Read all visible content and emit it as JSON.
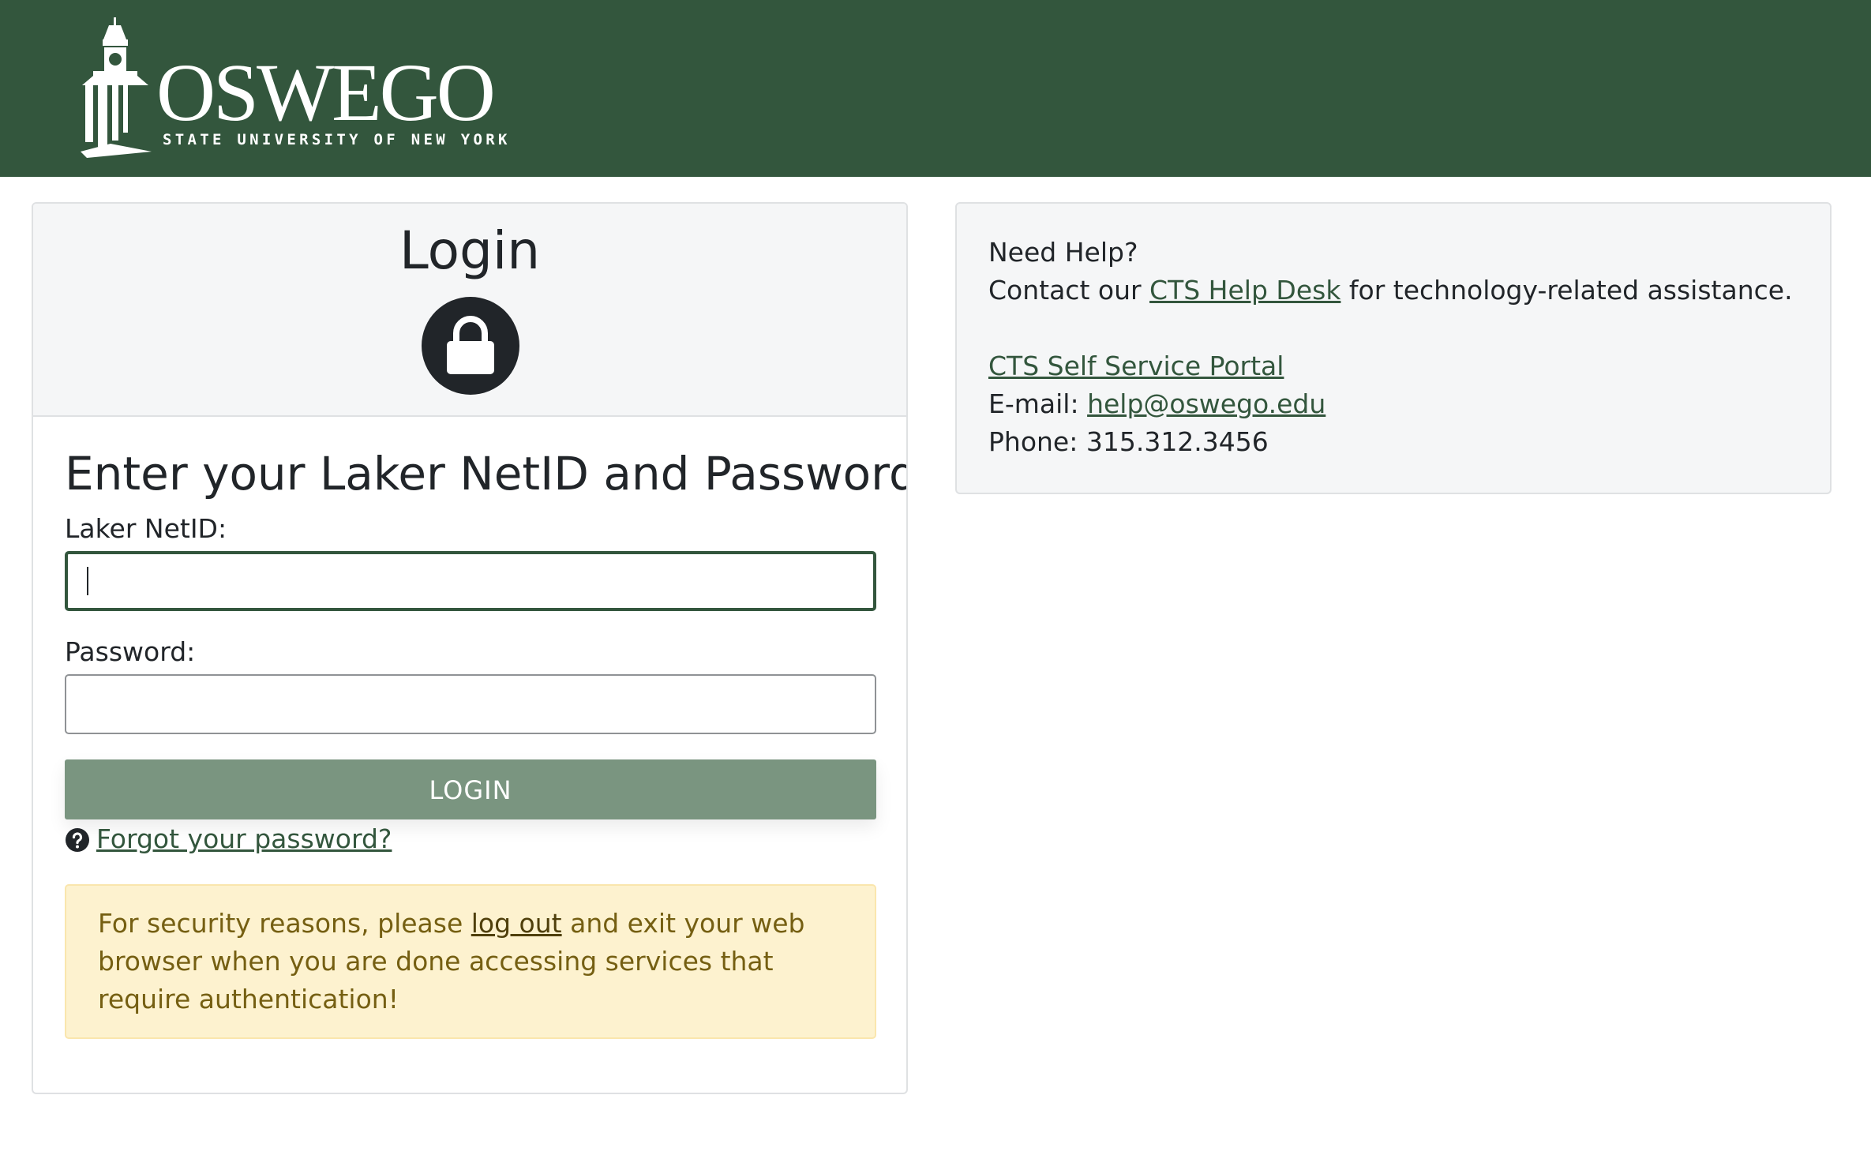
{
  "header": {
    "logo_text": "OSWEGO",
    "logo_subtext": "STATE UNIVERSITY OF NEW YORK",
    "background_color": "#33563d"
  },
  "login": {
    "title": "Login",
    "lock_icon": "lock-icon",
    "heading": "Enter your Laker NetID and Password",
    "netid_label": "Laker NetID:",
    "netid_value": "",
    "password_label": "Password:",
    "password_value": "",
    "button_label": "LOGIN",
    "button_color": "#7a9580",
    "forgot_icon": "question-circle-icon",
    "forgot_link": "Forgot your password?"
  },
  "security_notice": {
    "text_before": "For security reasons, please ",
    "link": "log out",
    "text_after": " and exit your web browser when you are done accessing services that require authentication!",
    "background_color": "#fdf2cf"
  },
  "help": {
    "title": "Need Help?",
    "contact_prefix": "Contact our ",
    "help_desk_link": "CTS Help Desk",
    "contact_suffix": " for technology-related assistance.",
    "portal_link": "CTS Self Service Portal",
    "email_label": "E-mail: ",
    "email_link": "help@oswego.edu",
    "phone_label": "Phone: ",
    "phone_value": "315.312.3456"
  }
}
